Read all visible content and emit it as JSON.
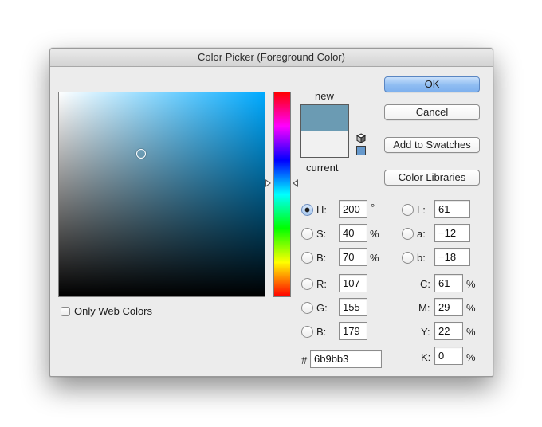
{
  "window": {
    "title": "Color Picker (Foreground Color)"
  },
  "picker": {
    "hue_position_fraction": 0.444,
    "field_marker_saturation": 0.4,
    "field_marker_brightness": 0.7,
    "pure_hue_color": "#00aaff"
  },
  "swatches": {
    "new_label": "new",
    "current_label": "current",
    "new_color": "#6b9bb3",
    "current_color": "#f1f1f1",
    "gamut_warning_icon": "cube-icon",
    "web_safe_icon": "web-safe-swatch-icon",
    "web_safe_color": "#6699cc"
  },
  "web_colors": {
    "label": "Only Web Colors",
    "checked": false
  },
  "buttons": {
    "ok": "OK",
    "cancel": "Cancel",
    "add_to_swatches": "Add to Swatches",
    "color_libraries": "Color Libraries"
  },
  "hsb": {
    "h": {
      "label": "H:",
      "value": "200",
      "unit": "°",
      "selected": true
    },
    "s": {
      "label": "S:",
      "value": "40",
      "unit": "%",
      "selected": false
    },
    "b": {
      "label": "B:",
      "value": "70",
      "unit": "%",
      "selected": false
    }
  },
  "rgb": {
    "r": {
      "label": "R:",
      "value": "107"
    },
    "g": {
      "label": "G:",
      "value": "155"
    },
    "b": {
      "label": "B:",
      "value": "179"
    }
  },
  "lab": {
    "l": {
      "label": "L:",
      "value": "61"
    },
    "a": {
      "label": "a:",
      "value": "−12"
    },
    "b": {
      "label": "b:",
      "value": "−18"
    }
  },
  "cmyk": {
    "c": {
      "label": "C:",
      "value": "61",
      "unit": "%"
    },
    "m": {
      "label": "M:",
      "value": "29",
      "unit": "%"
    },
    "y": {
      "label": "Y:",
      "value": "22",
      "unit": "%"
    },
    "k": {
      "label": "K:",
      "value": "0",
      "unit": "%"
    }
  },
  "hex": {
    "label": "#",
    "value": "6b9bb3"
  }
}
